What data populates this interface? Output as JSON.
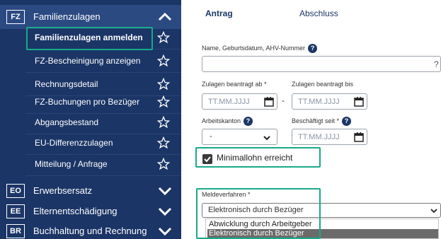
{
  "sidebar": {
    "top_section": {
      "code": "FZ",
      "label": "Familienzulagen"
    },
    "items": [
      {
        "label": "Familienzulagen anmelden"
      },
      {
        "label": "FZ-Bescheinigung anzeigen"
      },
      {
        "label": "Rechnungsdetail"
      },
      {
        "label": "FZ-Buchungen pro Bezüger"
      },
      {
        "label": "Abgangsbestand"
      },
      {
        "label": "EU-Differenzzulagen"
      },
      {
        "label": "Mitteilung / Anfrage"
      }
    ],
    "sections": [
      {
        "code": "EO",
        "label": "Erwerbsersatz"
      },
      {
        "code": "EE",
        "label": "Elternentschädigung"
      },
      {
        "code": "BR",
        "label": "Buchhaltung und Rechnung"
      }
    ]
  },
  "tabs": {
    "active": "Antrag",
    "other": "Abschluss"
  },
  "form": {
    "name_label": "Name, Geburtsdatum, AHV-Nummer",
    "name_suffix": "?",
    "from_label": "Zulagen beantragt ab *",
    "to_label": "Zulagen beantragt bis",
    "date_placeholder": "TT.MM.JJJJ",
    "range_dash": "-",
    "canton_label": "Arbeitskanton",
    "canton_value": "-",
    "employed_label": "Beschäftigt seit *",
    "min_wage_label": "Minimallohn erreicht",
    "procedure_label": "Meldeverfahren *",
    "procedure_value": "Elektronisch durch Bezüger",
    "procedure_options": [
      "Abwicklung durch Arbeitgeber",
      "Elektronisch durch Bezüger"
    ]
  },
  "colors": {
    "sidebar": "#1b3566",
    "accent": "#19a98a"
  }
}
